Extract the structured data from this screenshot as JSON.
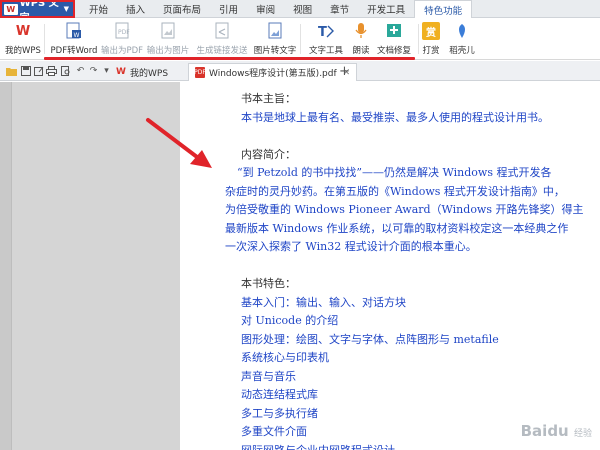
{
  "app": {
    "name": "WPS 文字",
    "logo": "W"
  },
  "menu": {
    "tabs": [
      "开始",
      "插入",
      "页面布局",
      "引用",
      "审阅",
      "视图",
      "章节",
      "开发工具",
      "特色功能"
    ],
    "active_index": 8
  },
  "ribbon": {
    "my_wps": "我的WPS",
    "pdf_to_word": "PDF转Word",
    "export_pdf": "输出为PDF",
    "export_image": "输出为图片",
    "gen_link": "生成链接发送",
    "image_to_text": "图片转文字",
    "text_tools": "文字工具",
    "read_aloud": "朗读",
    "repair": "文档修复",
    "reward": "打赏",
    "daoke": "稻壳儿"
  },
  "quickbar": {
    "my_wps_tab": "我的WPS",
    "doc_tab": "Windows程序设计(第五版).pdf",
    "new_tab_glyph": "+"
  },
  "document": {
    "lines": [
      {
        "text": "书本主旨：",
        "style": "hd"
      },
      {
        "text": "本书是地球上最有名、最受推崇、最多人使用的程式设计用书。",
        "style": "bl"
      },
      {
        "text": "",
        "style": "hd"
      },
      {
        "text": "内容简介：",
        "style": "hd"
      },
      {
        "text": "“到 Petzold 的书中找找”——仍然是解决 Windows 程式开发各",
        "style": "bl"
      },
      {
        "text": "杂症时的灵丹妙药。在第五版的《Windows 程式开发设计指南》中，",
        "style": "bl"
      },
      {
        "text": "为倍受敬重的 Windows Pioneer Award（Windows 开路先锋奖）得主",
        "style": "bl"
      },
      {
        "text": "最新版本 Windows 作业系统，以可靠的取材资料校定这一本经典之作",
        "style": "bl"
      },
      {
        "text": "一次深入探索了 Win32 程式设计介面的根本重心。",
        "style": "bl"
      },
      {
        "text": "",
        "style": "hd"
      },
      {
        "text": "本书特色：",
        "style": "hd"
      },
      {
        "text": "基本入门：输出、输入、对话方块",
        "style": "bl"
      },
      {
        "text": "对 Unicode 的介绍",
        "style": "bl"
      },
      {
        "text": "图形处理：绘图、文字与字体、点阵图形与 metafile",
        "style": "bl"
      },
      {
        "text": "系统核心与印表机",
        "style": "bl"
      },
      {
        "text": "声音与音乐",
        "style": "bl"
      },
      {
        "text": "动态连结程式库",
        "style": "bl"
      },
      {
        "text": "多工与多执行绪",
        "style": "bl"
      },
      {
        "text": "多重文件介面",
        "style": "bl"
      },
      {
        "text": "网际网路与企业内网路程式设计",
        "style": "bl"
      }
    ]
  },
  "watermark": {
    "brand": "Baidu",
    "sub": "经验"
  },
  "colors": {
    "accent": "#2b5aa8",
    "highlight": "#e0242a",
    "doc_text": "#1f45c6"
  }
}
